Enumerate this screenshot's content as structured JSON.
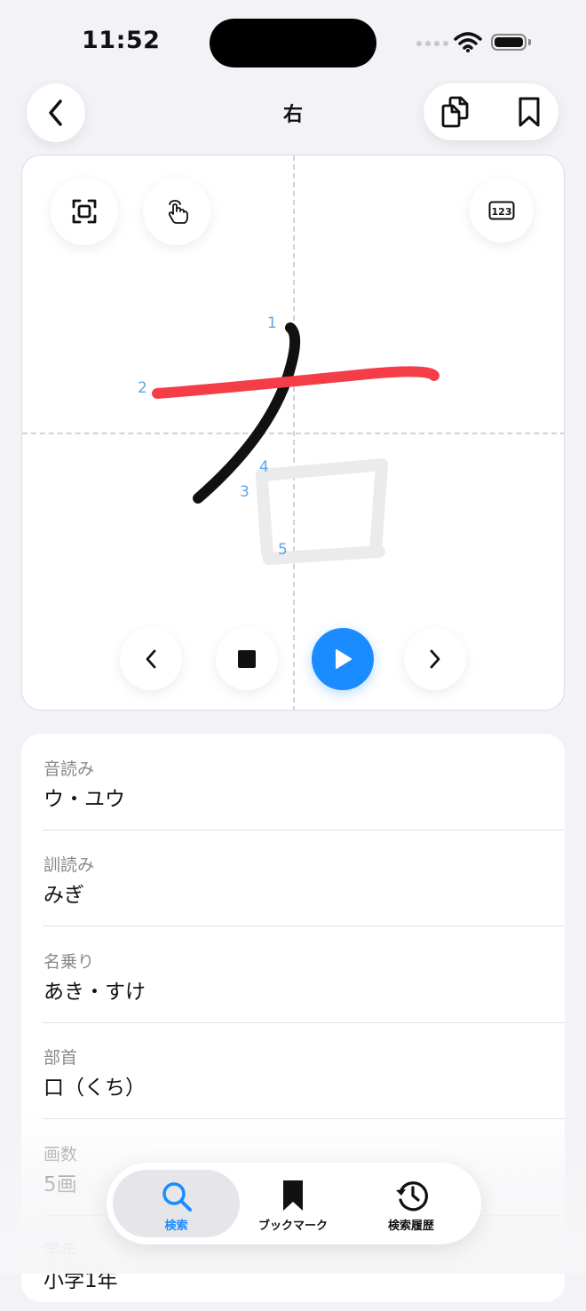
{
  "status_bar": {
    "time": "11:52"
  },
  "header": {
    "title": "右"
  },
  "stroke_numbers": [
    "1",
    "2",
    "3",
    "4",
    "5"
  ],
  "info": [
    {
      "label": "音読み",
      "value": "ウ・ユウ"
    },
    {
      "label": "訓読み",
      "value": "みぎ"
    },
    {
      "label": "名乗り",
      "value": "あき・すけ"
    },
    {
      "label": "部首",
      "value": "口（くち）"
    },
    {
      "label": "画数",
      "value": "5画"
    },
    {
      "label": "学年",
      "value": "小学1年"
    }
  ],
  "tabs": [
    {
      "label": "検索",
      "icon": "search-icon",
      "active": true
    },
    {
      "label": "ブックマーク",
      "icon": "bookmark-icon",
      "active": false
    },
    {
      "label": "検索履歴",
      "icon": "history-icon",
      "active": false
    }
  ],
  "colors": {
    "accent": "#1a8cff",
    "stroke_done": "#111111",
    "stroke_current": "#f53d47",
    "stroke_pending": "#ebebeb",
    "stroke_number": "#5aa7e8"
  }
}
